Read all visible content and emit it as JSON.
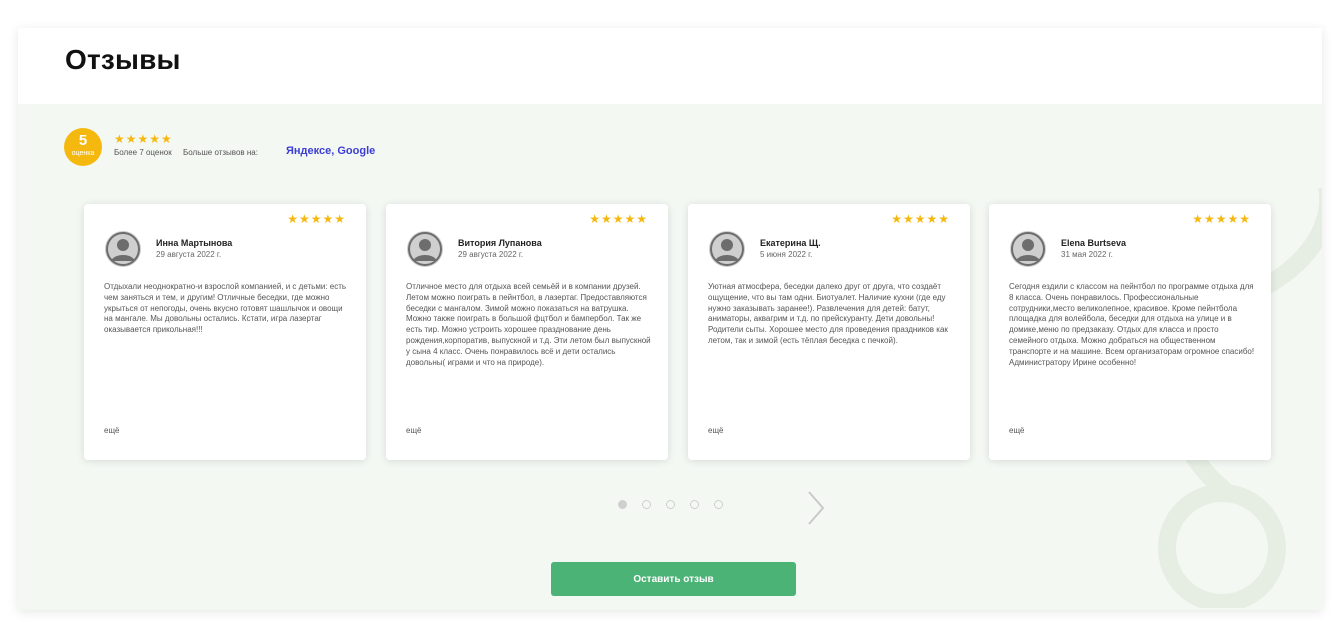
{
  "header": {
    "title": "Отзывы"
  },
  "rating": {
    "value": "5",
    "badge_label": "оценка",
    "stars": "★★★★★",
    "count_text": "Более 7 оценок",
    "more_label": "Больше отзывов на:",
    "more_links": "Яндексе, Google"
  },
  "reviews": [
    {
      "stars": "★★★★★",
      "author": "Инна Мартынова",
      "date": "29 августа 2022 г.",
      "text": "Отдыхали неоднократно-и взрослой компанией, и с детьми: есть чем заняться и тем, и другим! Отличные беседки, где можно укрыться от непогоды, очень вкусно готовят шашлычок и овощи на мангале. Мы довольны остались. Кстати, игра лазертаг оказывается прикольная!!!",
      "more": "ещё"
    },
    {
      "stars": "★★★★★",
      "author": "Витория Лупанова",
      "date": "29 августа 2022 г.",
      "text": "Отличное место для отдыха всей семьёй и в компании друзей. Летом можно поиграть в пейнтбол, в лазертаг. Предоставляются беседки с мангалом. Зимой можно показаться на ватрушка. Можно также поиграть в большой фцтбол и бампербол. Так же есть тир. Можно устроить хорошее празднование день рождения,корпоратив, выпускной и т.д. Эти летом был выпускной у сына 4 класс. Очень понравилось всё и дети остались довольны( играми и что на природе).",
      "more": "ещё"
    },
    {
      "stars": "★★★★★",
      "author": "Екатерина Щ.",
      "date": "5 июня 2022 г.",
      "text": "Уютная атмосфера, беседки далеко друг от друга, что создаёт ощущение, что вы там одни. Биотуалет. Наличие кухни (где еду нужно заказывать заранее!). Развлечения для детей: батут, аниматоры, аквагрим и т.д. по прейскуранту. Дети довольны! Родители сыты. Хорошее место для проведения праздников как летом, так и зимой (есть тёплая беседка с печкой).",
      "more": "ещё"
    },
    {
      "stars": "★★★★★",
      "author": "Elena Burtseva",
      "date": "31 мая 2022 г.",
      "text": "Сегодня ездили с классом на пейнтбол по программе отдыха для 8 класса. Очень понравилось. Профессиональные сотрудники,место великолепное, красивое. Кроме пейнтбола площадка для волейбола, беседки для отдыха на улице и в домике,меню по предзаказу. Отдых для класса и просто семейного отдыха. Можно добраться на общественном транспорте и на машине. Всем организаторам огромное спасибо! Администратору Ирине особенно!",
      "more": "ещё"
    }
  ],
  "pager": {
    "total": 5,
    "active": 1
  },
  "cta": {
    "label": "Оставить отзыв"
  },
  "colors": {
    "accent": "#f5b80e",
    "button": "#4cb377",
    "link": "#3b3ed1",
    "background": "#f4f8f3"
  }
}
